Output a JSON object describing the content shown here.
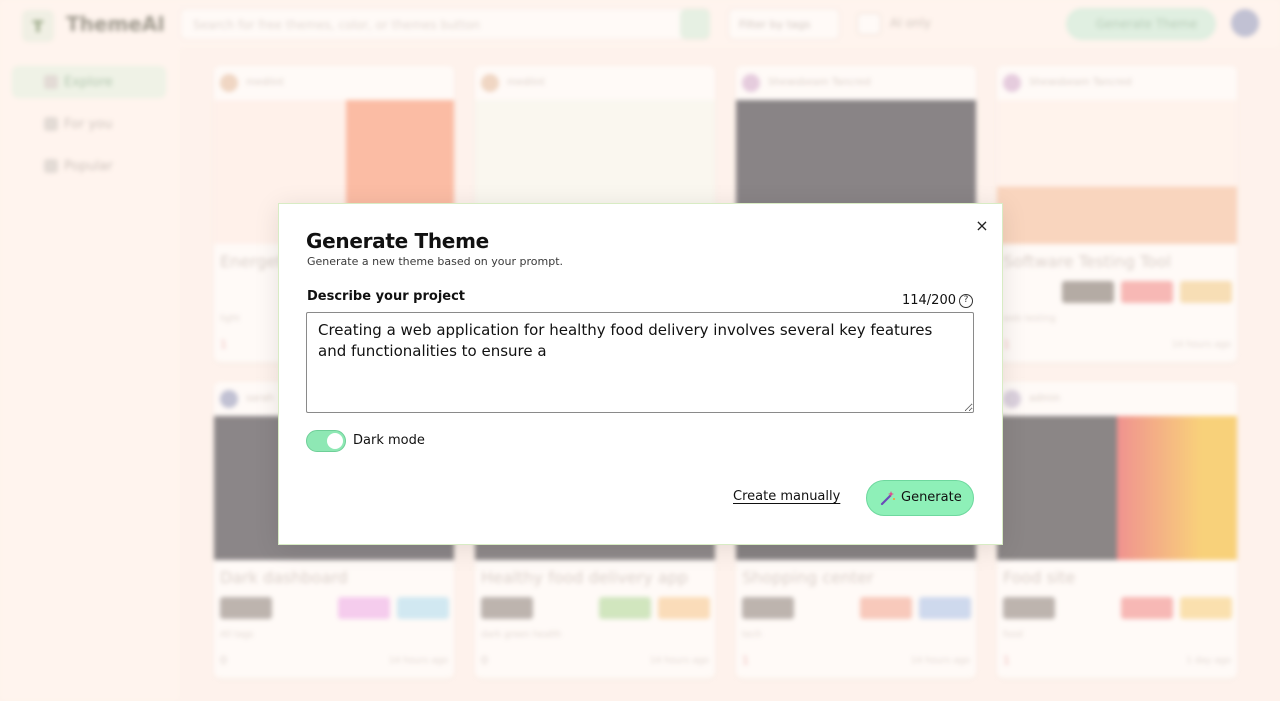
{
  "topbar": {
    "logo": "ThemeAI",
    "search_placeholder": "Search for free themes, color, or themes button",
    "filter_label": "Filter by tags",
    "ai_label": "AI only",
    "generate_label": "Generate Theme"
  },
  "sidebar": {
    "items": [
      {
        "label": "Explore"
      },
      {
        "label": "For you"
      },
      {
        "label": "Popular"
      }
    ]
  },
  "cards": [
    {
      "author": "mediint",
      "title": "Energet",
      "tags": "light",
      "likes": "1",
      "ago": ""
    },
    {
      "author": "mediint",
      "title": "",
      "tags": "",
      "likes": "",
      "ago": ""
    },
    {
      "author": "Shewsbeam Tancred",
      "title": "",
      "tags": "",
      "likes": "",
      "ago": ""
    },
    {
      "author": "Shewsbeam Tancred",
      "title": "Software Testing Tool",
      "tags": "web  testing",
      "likes": "1",
      "ago": "14 hours ago"
    },
    {
      "author": "sarah",
      "title": "Dark dashboard",
      "tags": "All tags",
      "likes": "0",
      "ago": "14 hours ago"
    },
    {
      "author": "",
      "title": "Healthy food delivery app",
      "tags": "dark  green  health",
      "likes": "0",
      "ago": "14 hours ago"
    },
    {
      "author": "",
      "title": "Shopping center",
      "tags": "tech",
      "likes": "1",
      "ago": "14 hours ago"
    },
    {
      "author": "admin",
      "title": "Food site",
      "tags": "food",
      "likes": "1",
      "ago": "1 day ago"
    }
  ],
  "modal": {
    "title": "Generate Theme",
    "subtitle": "Generate a new theme based on your prompt.",
    "field_label": "Describe your project",
    "counter": "114/200",
    "help_glyph": "?",
    "prompt_value": "Creating a web application for healthy food delivery involves several key features and functionalities to ensure a",
    "dark_mode_label": "Dark mode",
    "dark_mode_on": true,
    "create_manually": "Create manually",
    "generate": "Generate",
    "close_glyph": "×"
  },
  "colors": {
    "accent_green": "#8ef0b8",
    "page_bg": "#fdf3ee"
  }
}
